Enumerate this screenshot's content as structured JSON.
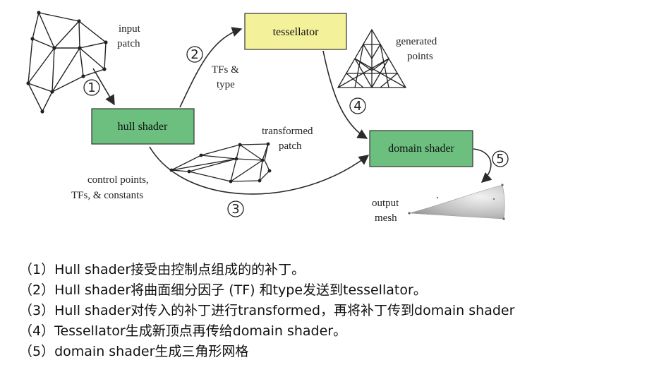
{
  "diagram": {
    "input_patch_label": [
      "input",
      "patch"
    ],
    "hull_shader_label": "hull shader",
    "tessellator_label": "tessellator",
    "domain_shader_label": "domain shader",
    "tfs_type_label": [
      "TFs &",
      "type"
    ],
    "generated_points_label": [
      "generated",
      "points"
    ],
    "transformed_patch_label": [
      "transformed",
      "patch"
    ],
    "control_points_label": [
      "control points,",
      "TFs, & constants"
    ],
    "output_mesh_label": [
      "output",
      "mesh"
    ],
    "step_markers": [
      "1",
      "2",
      "3",
      "4",
      "5"
    ],
    "colors": {
      "shader_box": "#6cbf7e",
      "tessellator_box": "#f3f29a",
      "box_border": "#333333",
      "arrow": "#2a2a2a"
    }
  },
  "notes": [
    "（1）Hull shader接受由控制点组成的的补丁。",
    "（2）Hull shader将曲面细分因子 (TF) 和type发送到tessellator。",
    "（3）Hull shader对传入的补丁进行transformed，再将补丁传到domain shader",
    "（4）Tessellator生成新顶点再传给domain shader。",
    "（5）domain shader生成三角形网格"
  ]
}
